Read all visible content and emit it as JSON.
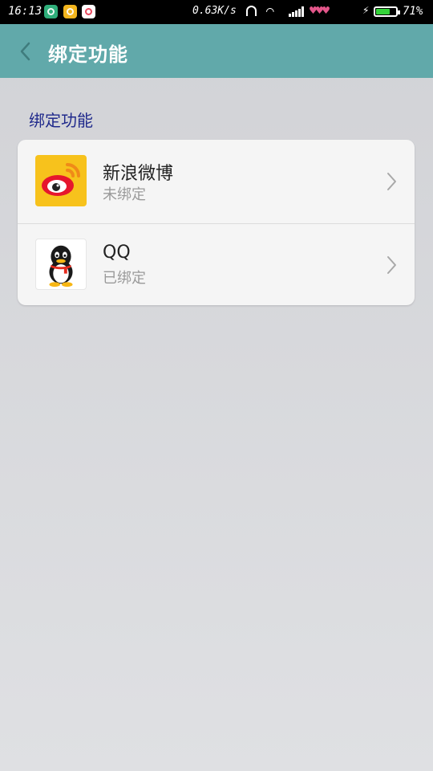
{
  "status_bar": {
    "time": "16:13",
    "net_speed": "0.63K/s",
    "battery_level": 0.71,
    "battery_text": "71%",
    "icons": [
      "app-shield-icon",
      "app-money-icon",
      "app-calendar-icon",
      "headset-icon",
      "wifi-icon",
      "signal-icon",
      "heart-icons",
      "charging-icon",
      "battery-icon"
    ]
  },
  "header": {
    "title": "绑定功能",
    "back_icon": "chevron-left-icon"
  },
  "section": {
    "title": "绑定功能"
  },
  "bindings": [
    {
      "name": "新浪微博",
      "status": "未绑定",
      "icon": "weibo-logo-icon"
    },
    {
      "name": "QQ",
      "status": "已绑定",
      "icon": "qq-logo-icon"
    }
  ],
  "colors": {
    "header_bg": "#61a9aa",
    "section_title": "#202a8c",
    "weibo_bg": "#f7c21c",
    "status_text": "#9a9a9a"
  }
}
